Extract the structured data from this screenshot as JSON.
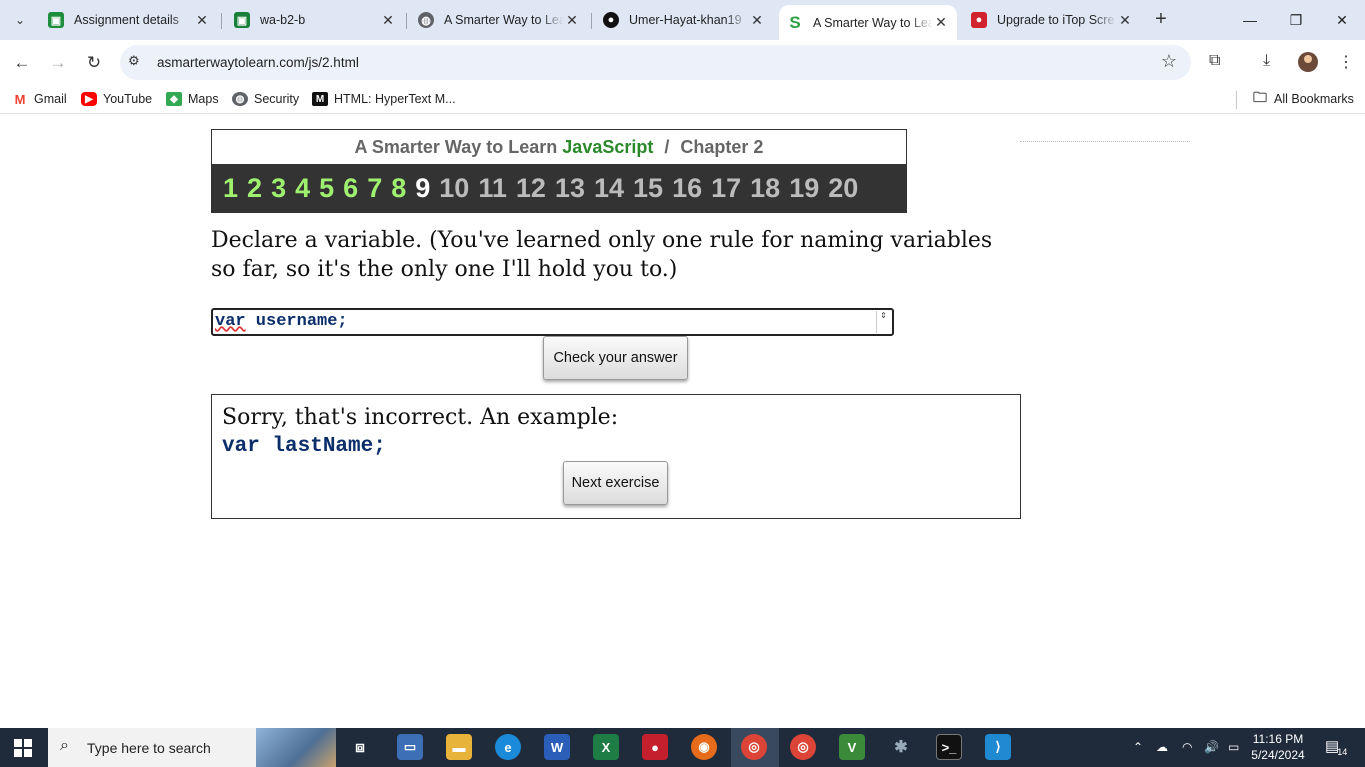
{
  "browser": {
    "tabs": [
      {
        "title": "Assignment details",
        "icon": "classroom-icon",
        "color": "#1e8e3e",
        "active": false
      },
      {
        "title": "wa-b2-b",
        "icon": "classroom-icon",
        "color": "#188038",
        "active": false
      },
      {
        "title": "A Smarter Way to Lea",
        "icon": "globe-icon",
        "color": "#5f6368",
        "active": false
      },
      {
        "title": "Umer-Hayat-khan19",
        "icon": "github-icon",
        "color": "#111111",
        "active": false
      },
      {
        "title": "A Smarter Way to Lea",
        "icon": "s-logo-icon",
        "color": "#2ea043",
        "active": true
      },
      {
        "title": "Upgrade to iTop Scre",
        "icon": "recorder-icon",
        "color": "#d0222f",
        "active": false
      }
    ],
    "address": "asmarterwaytolearn.com/js/2.html",
    "bookmarks": [
      {
        "label": "Gmail",
        "icon": "gmail-icon"
      },
      {
        "label": "YouTube",
        "icon": "youtube-icon"
      },
      {
        "label": "Maps",
        "icon": "maps-icon"
      },
      {
        "label": "Security",
        "icon": "globe-icon"
      },
      {
        "label": "HTML: HyperText M...",
        "icon": "mdn-icon"
      }
    ],
    "all_bookmarks": "All Bookmarks"
  },
  "page": {
    "title_prefix": "A Smarter Way to Learn",
    "title_js": "JavaScript",
    "title_sep": "/",
    "title_chapter": "Chapter 2",
    "exercise_numbers": [
      "1",
      "2",
      "3",
      "4",
      "5",
      "6",
      "7",
      "8",
      "9",
      "10",
      "11",
      "12",
      "13",
      "14",
      "15",
      "16",
      "17",
      "18",
      "19",
      "20"
    ],
    "completed_count": 8,
    "current_exercise": "9",
    "prompt": "Declare a variable. (You've learned only one rule for naming variables so far, so it's the only one I'll hold you to.)",
    "answer_keyword": "var",
    "answer_rest": " username;",
    "check_button": "Check your answer",
    "result_message": "Sorry, that's incorrect. An example:",
    "example_code": "var lastName;",
    "next_button": "Next exercise",
    "colors": {
      "done": "#a0f070",
      "current": "#ffffff",
      "todo": "#bbbbbb",
      "js": "#2a8a2a",
      "code": "#0b2e6b"
    }
  },
  "taskbar": {
    "search_placeholder": "Type here to search",
    "time": "11:16 PM",
    "date": "5/24/2024",
    "notifications": "14",
    "apps": [
      "task-view-icon",
      "file-explorer-icon",
      "folder-icon",
      "edge-icon",
      "word-icon",
      "excel-icon",
      "recorder-icon",
      "firefox-icon",
      "chrome-icon",
      "chrome-profile-icon",
      "vim-icon",
      "spider-icon",
      "terminal-icon",
      "vscode-icon"
    ]
  }
}
